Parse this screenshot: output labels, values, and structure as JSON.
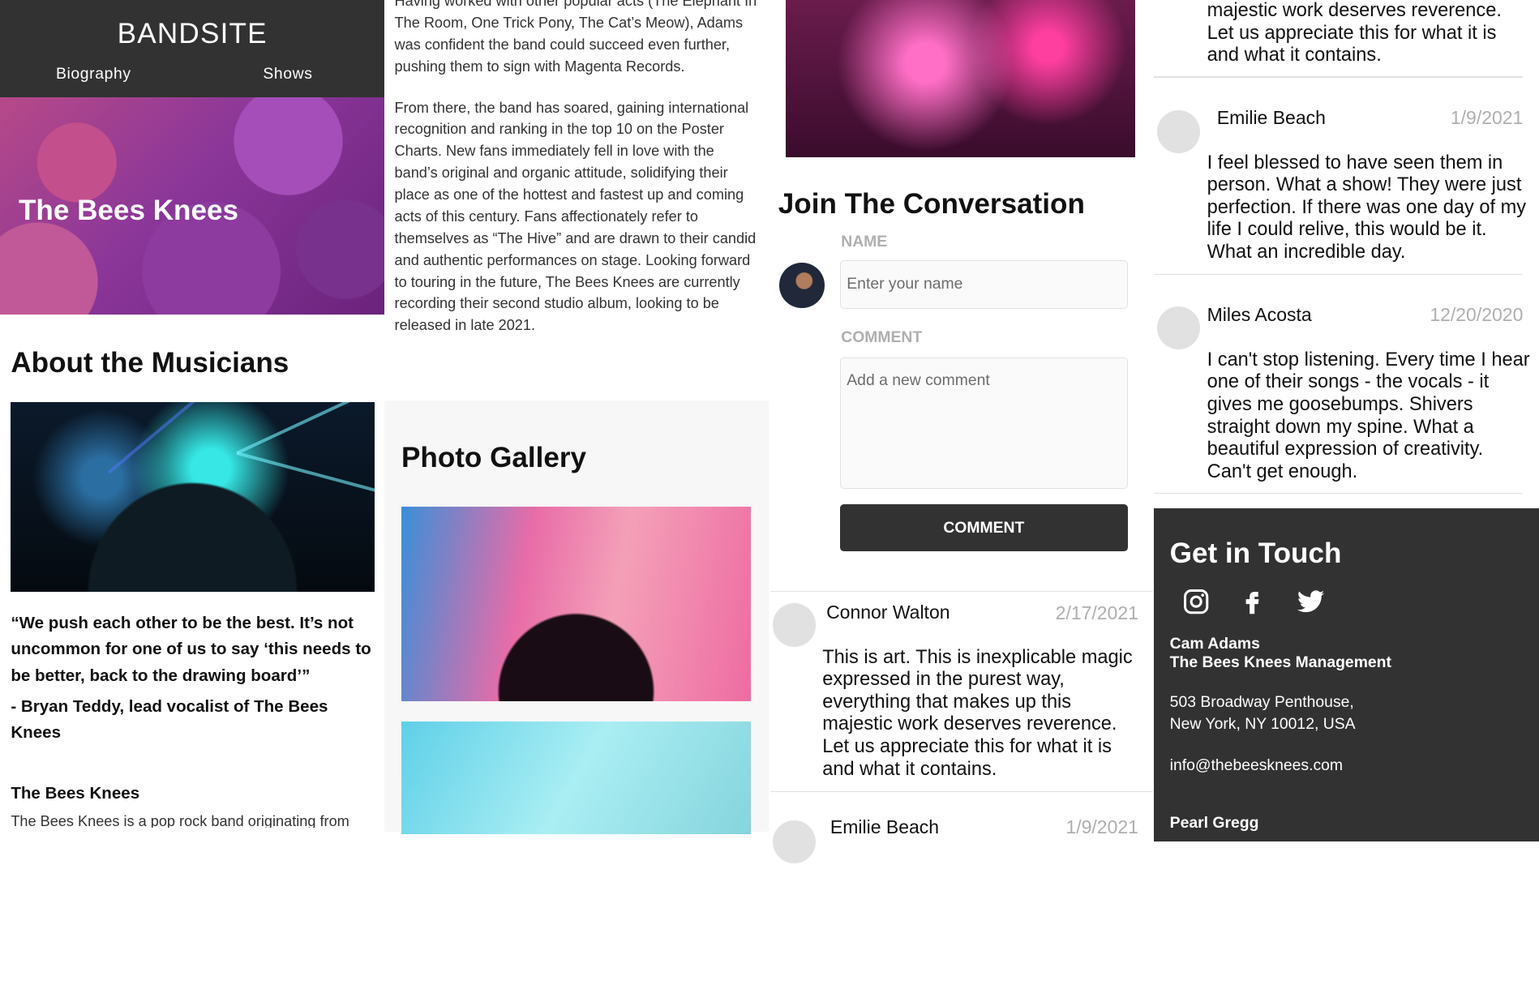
{
  "header": {
    "logo": "BANDSITE",
    "nav": [
      {
        "label": "Biography"
      },
      {
        "label": "Shows"
      }
    ]
  },
  "hero": {
    "title": "The Bees Knees"
  },
  "about": {
    "title": "About the Musicians",
    "quote": "“We push each other to be the best. It’s not uncommon for one of us to say ‘this needs to be better, back to the drawing board’”",
    "quote_author": "- Bryan Teddy, lead vocalist of The Bees Knees",
    "bio_title": "The Bees Knees",
    "bio_text": "The Bees Knees is a pop rock band originating from",
    "bio_cont_1": "Having worked with other popular acts (The Elephant In The Room, One Trick Pony, The Cat’s Meow), Adams was confident the band could succeed even further, pushing them to sign with Magenta Records.",
    "bio_cont_2": "From there, the band has soared, gaining international recognition and ranking in the top 10 on the Poster Charts. New fans immediately fell in love with the band’s original and organic attitude, solidifying their place as one of the hottest and fastest up and coming acts of this century. Fans affectionately refer to themselves as “The Hive” and are drawn to their candid and authentic performances on stage. Looking forward to touring in the future, The Bees Knees are currently recording their second studio album, looking to be released in late 2021."
  },
  "gallery": {
    "title": "Photo Gallery"
  },
  "conversation": {
    "title": "Join The Conversation",
    "name_label": "NAME",
    "name_placeholder": "Enter your name",
    "comment_label": "COMMENT",
    "comment_placeholder": "Add a new comment",
    "button": "COMMENT"
  },
  "comments_col3": [
    {
      "name": "Connor Walton",
      "date": "2/17/2021",
      "text": "This is art. This is inexplicable magic expressed in the purest way, everything that makes up this majestic work deserves reverence. Let us appreciate this for what it is and what it contains."
    },
    {
      "name": "Emilie Beach",
      "date": "1/9/2021"
    }
  ],
  "comments_col4": {
    "partial_text": "majestic work deserves reverence. Let us appreciate this for what it is and what it contains.",
    "items": [
      {
        "name": "Emilie Beach",
        "date": "1/9/2021",
        "text": "I feel blessed to have seen them in person. What a show! They were just perfection. If there was one day of my life I could relive, this would be it. What an incredible day."
      },
      {
        "name": "Miles Acosta",
        "date": "12/20/2020",
        "text": "I can't stop listening. Every time I hear one of their songs - the vocals - it gives me goosebumps. Shivers straight down my spine. What a beautiful expression of creativity. Can't get enough."
      }
    ]
  },
  "footer": {
    "title": "Get in Touch",
    "icons": [
      "instagram-icon",
      "facebook-icon",
      "twitter-icon"
    ],
    "contact_name": "Cam Adams",
    "contact_org": "The Bees Knees Management",
    "address_1": "503 Broadway Penthouse,",
    "address_2": "New York, NY 10012, USA",
    "email": "info@thebeesknees.com",
    "next_name": "Pearl Gregg"
  }
}
